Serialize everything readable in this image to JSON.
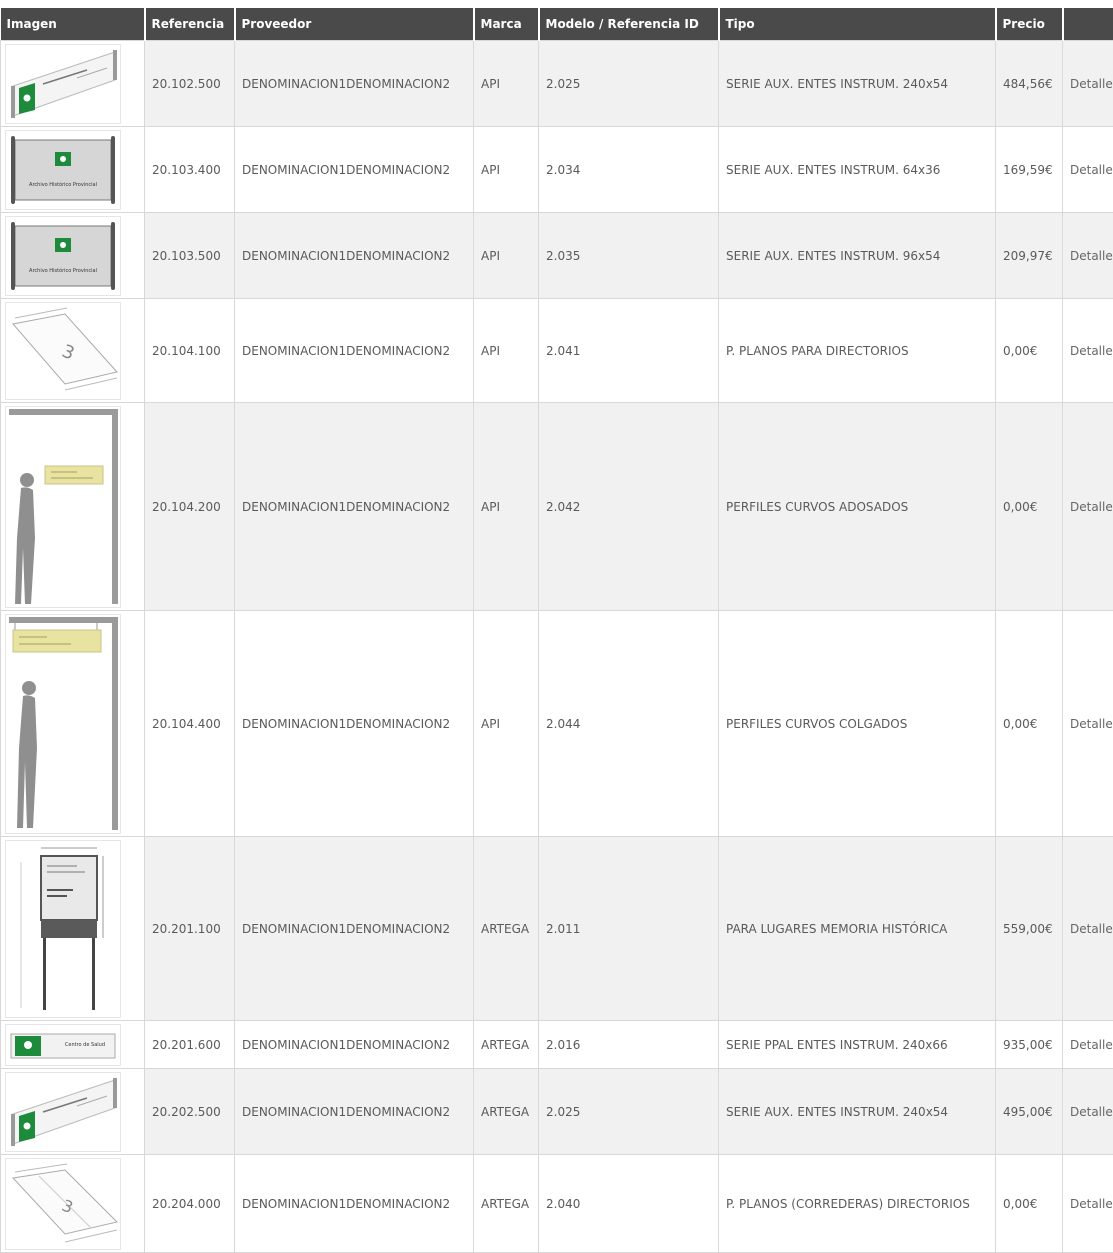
{
  "table": {
    "headers": {
      "image": "Imagen",
      "reference": "Referencia",
      "supplier": "Proveedor",
      "brand": "Marca",
      "model": "Modelo / Referencia ID",
      "type": "Tipo",
      "price": "Precio",
      "actions": ""
    },
    "rows": [
      {
        "icon": "angled-sign-icon",
        "reference": "20.102.500",
        "supplier": "DENOMINACION1DENOMINACION2",
        "brand": "API",
        "model": "2.025",
        "type": "SERIE AUX. ENTES INSTRUM. 240x54",
        "price": "484,56€",
        "detail": "Detalle"
      },
      {
        "icon": "framed-panel-sign-icon",
        "reference": "20.103.400",
        "supplier": "DENOMINACION1DENOMINACION2",
        "brand": "API",
        "model": "2.034",
        "type": "SERIE AUX. ENTES INSTRUM. 64x36",
        "price": "169,59€",
        "detail": "Detalle",
        "sign_text": "Archivo Histórico Provincial"
      },
      {
        "icon": "framed-panel-sign-icon",
        "reference": "20.103.500",
        "supplier": "DENOMINACION1DENOMINACION2",
        "brand": "API",
        "model": "2.035",
        "type": "SERIE AUX. ENTES INSTRUM. 96x54",
        "price": "209,97€",
        "detail": "Detalle",
        "sign_text": "Archivo Histórico Provincial"
      },
      {
        "icon": "directory-plane-icon",
        "reference": "20.104.100",
        "supplier": "DENOMINACION1DENOMINACION2",
        "brand": "API",
        "model": "2.041",
        "type": "P. PLANOS PARA DIRECTORIOS",
        "price": "0,00€",
        "detail": "Detalle"
      },
      {
        "icon": "wall-mounted-profile-icon",
        "reference": "20.104.200",
        "supplier": "DENOMINACION1DENOMINACION2",
        "brand": "API",
        "model": "2.042",
        "type": "PERFILES CURVOS ADOSADOS",
        "price": "0,00€",
        "detail": "Detalle"
      },
      {
        "icon": "hanging-profile-icon",
        "reference": "20.104.400",
        "supplier": "DENOMINACION1DENOMINACION2",
        "brand": "API",
        "model": "2.044",
        "type": "PERFILES CURVOS COLGADOS",
        "price": "0,00€",
        "detail": "Detalle"
      },
      {
        "icon": "memory-post-sign-icon",
        "reference": "20.201.100",
        "supplier": "DENOMINACION1DENOMINACION2",
        "brand": "ARTEGA",
        "model": "2.011",
        "type": "PARA LUGARES MEMORIA HISTÓRICA",
        "price": "559,00€",
        "detail": "Detalle"
      },
      {
        "icon": "flat-main-sign-icon",
        "reference": "20.201.600",
        "supplier": "DENOMINACION1DENOMINACION2",
        "brand": "ARTEGA",
        "model": "2.016",
        "type": "SERIE PPAL ENTES INSTRUM. 240x66",
        "price": "935,00€",
        "detail": "Detalle",
        "sign_text": "Centro de Salud"
      },
      {
        "icon": "angled-sign-icon",
        "reference": "20.202.500",
        "supplier": "DENOMINACION1DENOMINACION2",
        "brand": "ARTEGA",
        "model": "2.025",
        "type": "SERIE AUX. ENTES INSTRUM. 240x54",
        "price": "495,00€",
        "detail": "Detalle"
      },
      {
        "icon": "sliding-directory-icon",
        "reference": "20.204.000",
        "supplier": "DENOMINACION1DENOMINACION2",
        "brand": "ARTEGA",
        "model": "2.040",
        "type": "P. PLANOS (CORREDERAS) DIRECTORIOS",
        "price": "0,00€",
        "detail": "Detalle"
      }
    ]
  },
  "colors": {
    "header_bg": "#4a4a4a",
    "row_alt": "#f1f1f1",
    "junta_green": "#1e8a3c",
    "sign_grey": "#8a8a8a",
    "info_yellow": "#e8e3a0"
  }
}
